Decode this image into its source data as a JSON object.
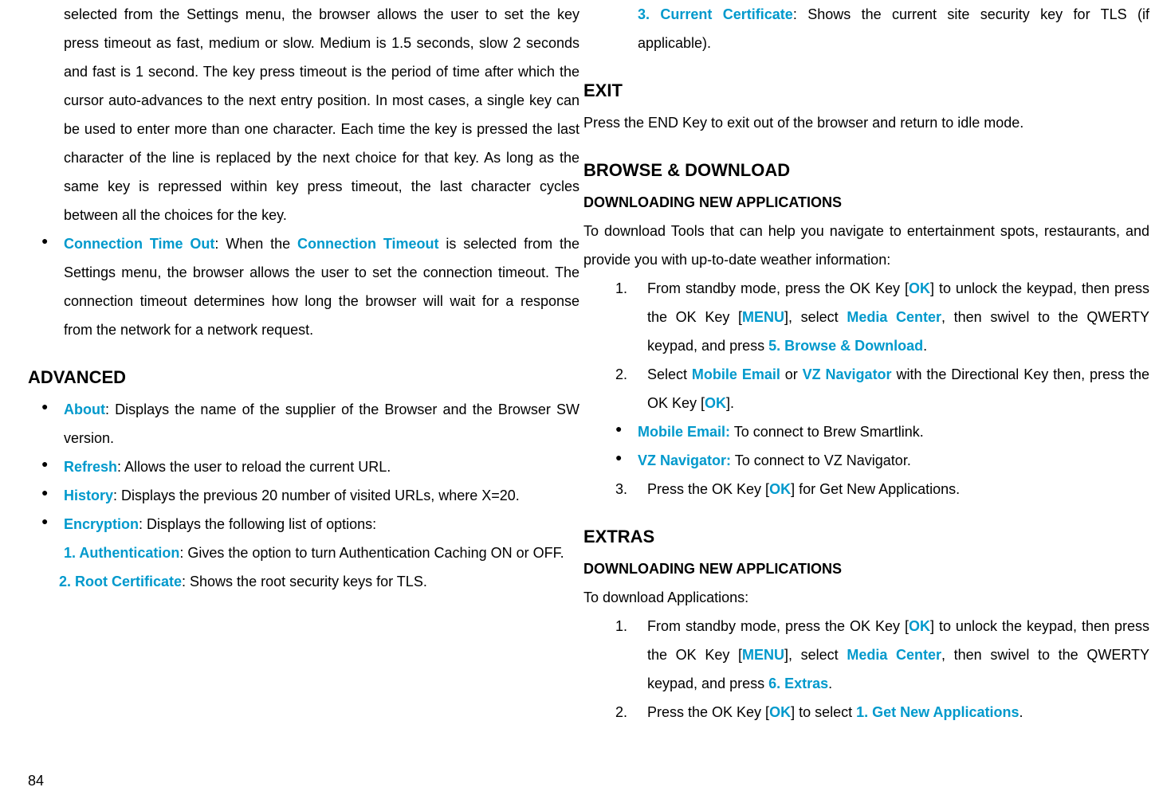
{
  "left_column": {
    "top_paragraph": "selected from the Settings menu, the browser allows the user to set the key press timeout as fast, medium or slow. Medium is 1.5 seconds, slow 2 seconds and fast is 1 second. The key press timeout is the period of time after which the cursor auto-advances to the next entry position. In most cases, a single key can be used to enter more than one character. Each time the key is pressed the last character of the line is replaced by the next choice for that key. As long as the same key is repressed within key press timeout, the last character cycles between all the choices for the key.",
    "connection_bullet": {
      "label": "Connection Time Out",
      "text1": ": When the ",
      "label2": "Connection Timeout",
      "text2": " is selected from the Settings menu, the browser allows the user to set the connection timeout. The connection timeout determines how long the browser will wait for a response from the network for a network request."
    },
    "advanced_heading": "ADVANCED",
    "advanced_items": {
      "about": {
        "label": "About",
        "text": ": Displays the name of the supplier of the Browser and the Browser SW version."
      },
      "refresh": {
        "label": "Refresh",
        "text": ": Allows the user to reload the current URL."
      },
      "history": {
        "label": "History",
        "text": ": Displays the previous 20 number of visited URLs, where X=20."
      },
      "encryption": {
        "label": "Encryption",
        "text": ": Displays the following list of options:",
        "sub1": {
          "label": "1. Authentication",
          "text": ": Gives the option to turn Authentication Caching ON or OFF."
        },
        "sub2": {
          "label": "2. Root Certificate",
          "text": ": Shows the root security keys for TLS."
        }
      }
    }
  },
  "right_column": {
    "cert3": {
      "label": "3. Current Certificate",
      "text": ": Shows the current site security key for TLS (if applicable)."
    },
    "exit_heading": "EXIT",
    "exit_text": "Press the END Key to exit out of the browser and return to idle mode.",
    "browse_heading": "BROWSE & DOWNLOAD",
    "browse_sub": "DOWNLOADING NEW APPLICATIONS",
    "browse_intro": "To download Tools that can help you navigate to entertainment spots, restaurants, and provide you with up-to-date weather information:",
    "browse_step1": {
      "num": "1.",
      "t1": "From standby mode, press the OK Key [",
      "ok1": "OK",
      "t2": "] to unlock the keypad, then press the OK Key [",
      "menu": "MENU",
      "t3": "], select ",
      "mc": "Media Center",
      "t4": ", then swivel to the QWERTY keypad, and press ",
      "bd": "5. Browse & Download",
      "t5": "."
    },
    "browse_step2": {
      "num": "2.",
      "t1": "Select ",
      "me": "Mobile Email",
      "t2": " or ",
      "vz": "VZ Navigator",
      "t3": " with the Directional Key then, press the OK Key [",
      "ok": "OK",
      "t4": "]."
    },
    "browse_bullet1": {
      "label": "Mobile Email:",
      "text": " To connect to Brew Smartlink."
    },
    "browse_bullet2": {
      "label": "VZ Navigator:",
      "text": " To connect to VZ Navigator."
    },
    "browse_step3": {
      "num": "3.",
      "t1": "Press the OK Key [",
      "ok": "OK",
      "t2": "] for Get New Applications."
    },
    "extras_heading": "EXTRAS",
    "extras_sub": "DOWNLOADING NEW APPLICATIONS",
    "extras_intro": "To download Applications:",
    "extras_step1": {
      "num": "1.",
      "t1": "From standby mode, press the OK Key [",
      "ok1": "OK",
      "t2": "] to unlock the keypad, then press the OK Key [",
      "menu": "MENU",
      "t3": "], select ",
      "mc": "Media Center",
      "t4": ", then swivel to the QWERTY keypad, and press  ",
      "ex": "6. Extras",
      "t5": "."
    },
    "extras_step2": {
      "num": "2.",
      "t1": "Press the OK Key [",
      "ok": "OK",
      "t2": "] to select ",
      "gna": "1. Get New Applications",
      "t3": "."
    }
  },
  "page_number": "84"
}
